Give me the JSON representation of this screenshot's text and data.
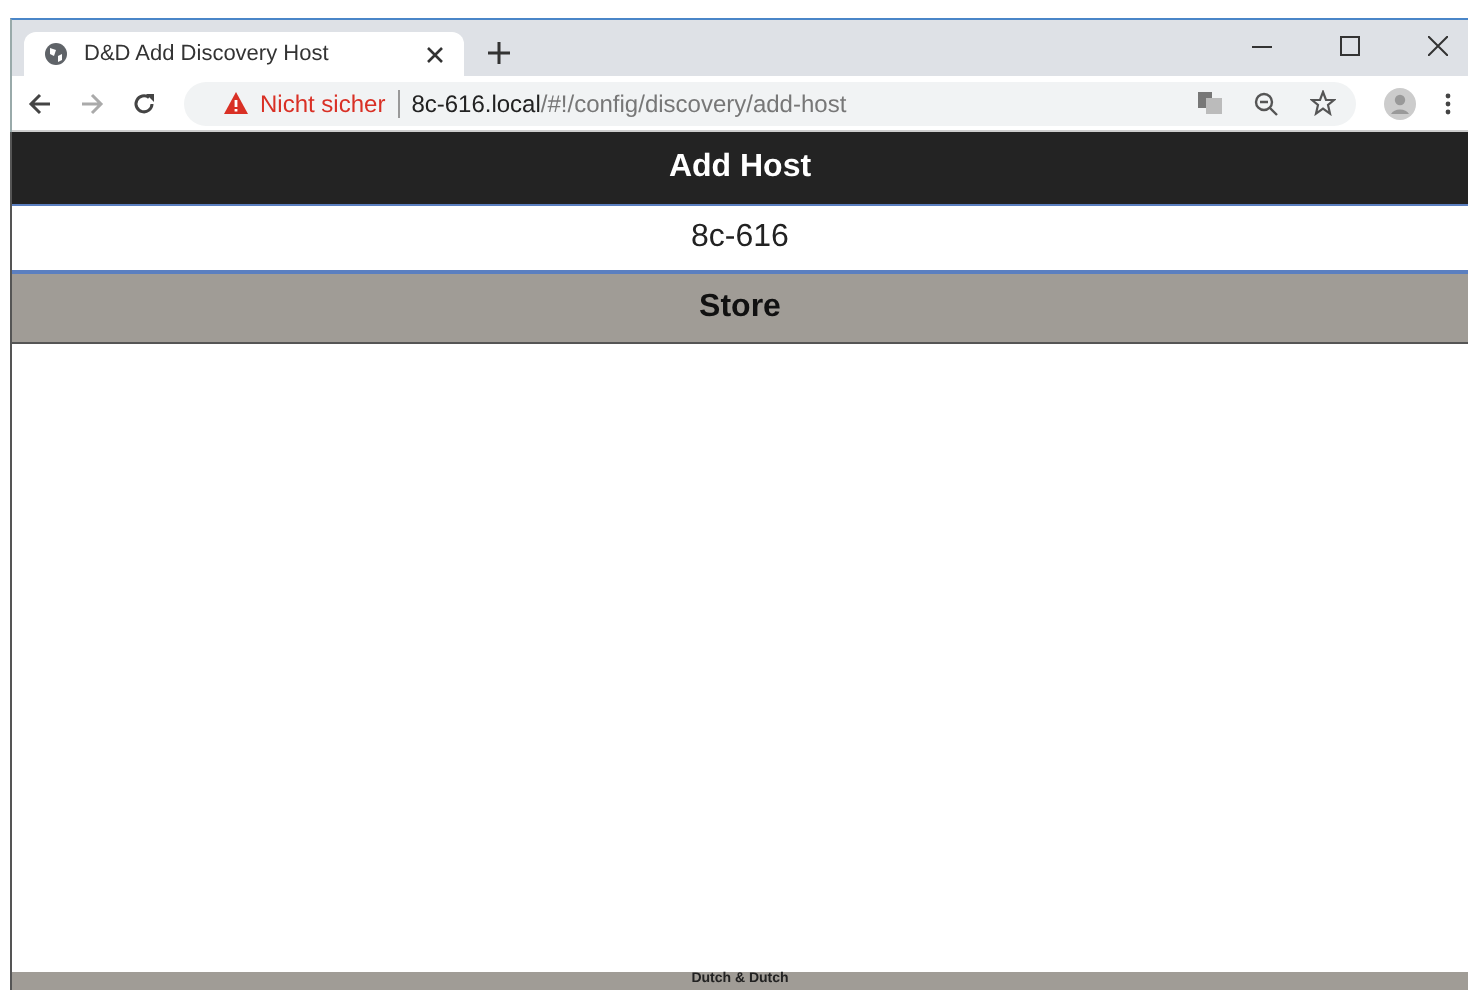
{
  "browser": {
    "tab": {
      "title": "D&D Add Discovery Host"
    },
    "address": {
      "security": "Nicht sicher",
      "host": "8c-616.local",
      "path": "/#!/config/discovery/add-host"
    }
  },
  "page": {
    "header": "Add Host",
    "host_field": {
      "value": "8c-616"
    },
    "store_button": "Store",
    "footer": "Dutch & Dutch"
  }
}
